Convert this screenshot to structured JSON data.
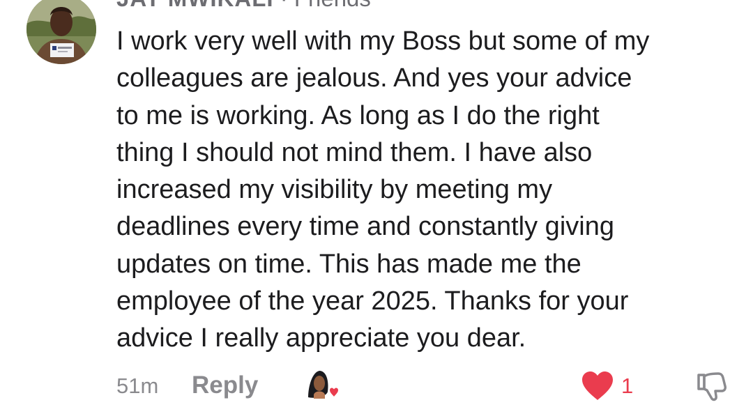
{
  "author": {
    "name": "JAY MWIKALI",
    "separator": " · ",
    "relationship": "Friends"
  },
  "avatar": {
    "icon": "profile-photo",
    "badge_text": "Nzarna Nixi"
  },
  "comment": {
    "lines": [
      "I work very well with my Boss but some of my",
      "colleagues are jealous. And yes your advice",
      "to me is working. As long as I do the right",
      "thing I should not mind them. I have also",
      "increased my visibility by meeting my",
      "deadlines every time and constantly giving",
      "updates on time. This has made me the",
      "employee of the year 2025. Thanks for your",
      "advice I really appreciate you dear."
    ]
  },
  "footer": {
    "timestamp": "51m",
    "reply_label": "Reply",
    "reactor_icon": "author-liked-avatar-icon",
    "like_icon": "heart-icon",
    "like_count": "1",
    "dislike_icon": "thumbs-down-icon"
  },
  "colors": {
    "text": "#1c1c1e",
    "secondary": "#8a8a8e",
    "heart": "#ea3c4e"
  }
}
